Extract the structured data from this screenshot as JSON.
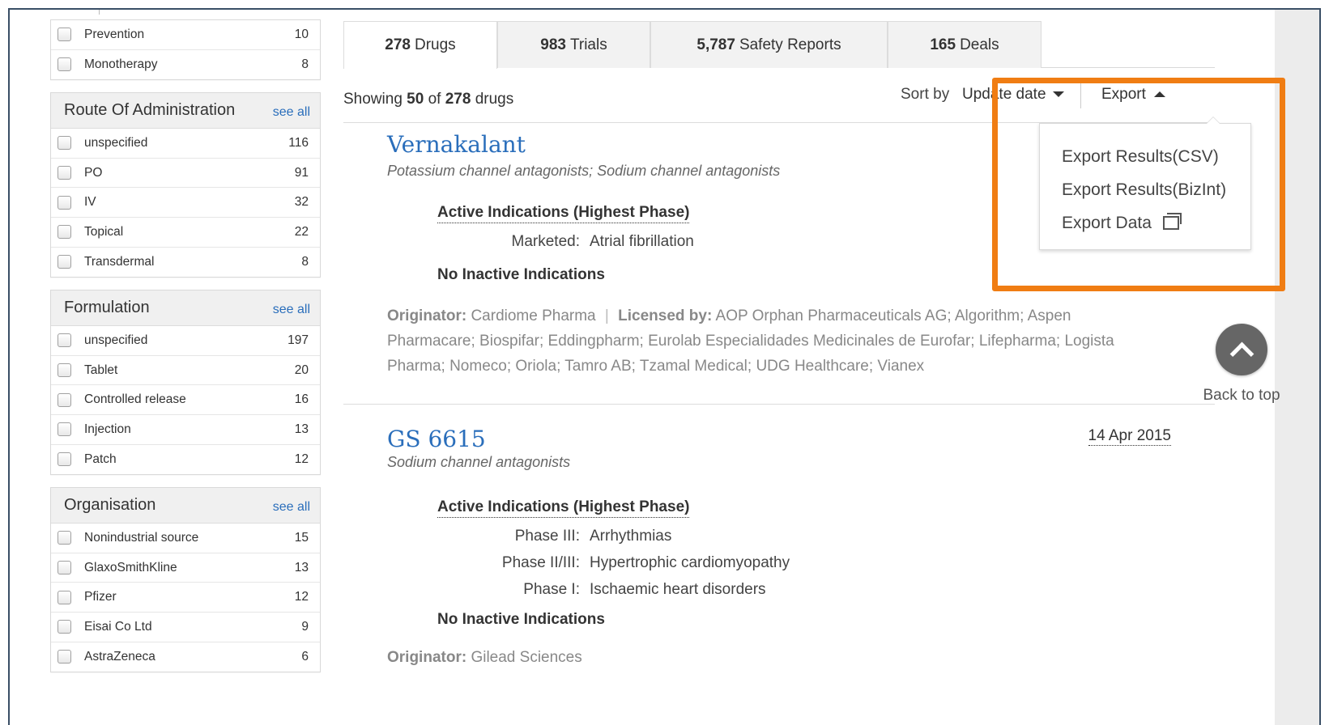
{
  "sidebar": {
    "top_facets": [
      {
        "label": "Prevention",
        "count": "10"
      },
      {
        "label": "Monotherapy",
        "count": "8"
      }
    ],
    "panels": [
      {
        "title": "Route Of Administration",
        "see_all": "see all",
        "items": [
          {
            "label": "unspecified",
            "count": "116"
          },
          {
            "label": "PO",
            "count": "91"
          },
          {
            "label": "IV",
            "count": "32"
          },
          {
            "label": "Topical",
            "count": "22"
          },
          {
            "label": "Transdermal",
            "count": "8"
          }
        ]
      },
      {
        "title": "Formulation",
        "see_all": "see all",
        "items": [
          {
            "label": "unspecified",
            "count": "197"
          },
          {
            "label": "Tablet",
            "count": "20"
          },
          {
            "label": "Controlled release",
            "count": "16"
          },
          {
            "label": "Injection",
            "count": "13"
          },
          {
            "label": "Patch",
            "count": "12"
          }
        ]
      },
      {
        "title": "Organisation",
        "see_all": "see all",
        "items": [
          {
            "label": "Nonindustrial source",
            "count": "15"
          },
          {
            "label": "GlaxoSmithKline",
            "count": "13"
          },
          {
            "label": "Pfizer",
            "count": "12"
          },
          {
            "label": "Eisai Co Ltd",
            "count": "9"
          },
          {
            "label": "AstraZeneca",
            "count": "6"
          }
        ]
      }
    ]
  },
  "tabs": [
    {
      "count": "278",
      "label": "Drugs"
    },
    {
      "count": "983",
      "label": "Trials"
    },
    {
      "count": "5,787",
      "label": "Safety Reports"
    },
    {
      "count": "165",
      "label": "Deals"
    }
  ],
  "toolbar": {
    "showing_prefix": "Showing",
    "showing_count": "50",
    "showing_of": "of",
    "showing_total": "278",
    "showing_suffix": "drugs",
    "sort_label": "Sort by",
    "sort_value": "Update date",
    "export_label": "Export"
  },
  "export_menu": {
    "items": [
      "Export Results(CSV)",
      "Export Results(BizInt)",
      "Export Data"
    ]
  },
  "drugs": [
    {
      "name": "Vernakalant",
      "class": "Potassium channel antagonists; Sodium channel antagonists",
      "active_heading": "Active Indications (Highest Phase)",
      "indications": [
        {
          "phase": "Marketed:",
          "name": "Atrial fibrillation"
        }
      ],
      "inactive": "No Inactive Indications",
      "originator_label": "Originator:",
      "originator": "Cardiome Pharma",
      "licensed_label": "Licensed by:",
      "licensed_line1": "AOP Orphan Pharmaceuticals AG; Algorithm; Aspen",
      "licensed_line2": "Pharmacare; Biospifar; Eddingpharm; Eurolab Especialidades Medicinales de Eurofar; Lifepharma; Logista",
      "licensed_line3": "Pharma; Nomeco; Oriola; Tamro AB; Tzamal Medical; UDG Healthcare; Vianex"
    },
    {
      "name": "GS 6615",
      "date": "14 Apr 2015",
      "class": "Sodium channel antagonists",
      "active_heading": "Active Indications (Highest Phase)",
      "indications": [
        {
          "phase": "Phase III:",
          "name": "Arrhythmias"
        },
        {
          "phase": "Phase II/III:",
          "name": "Hypertrophic cardiomyopathy"
        },
        {
          "phase": "Phase I:",
          "name": "Ischaemic heart disorders"
        }
      ],
      "inactive": "No Inactive Indications",
      "originator_label": "Originator:",
      "originator": "Gilead Sciences"
    }
  ],
  "back_to_top": "Back to top",
  "colors": {
    "link": "#2a6ebb",
    "highlight": "#f07d13",
    "frame": "#3a4f66"
  }
}
